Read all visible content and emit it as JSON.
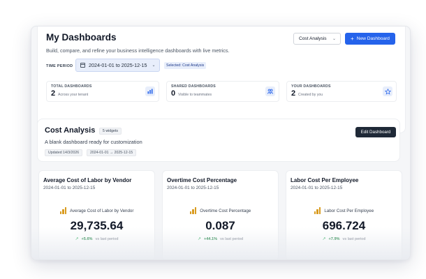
{
  "header": {
    "title": "My Dashboards",
    "subtitle": "Build, compare, and refine your business intelligence dashboards with live metrics.",
    "dashboard_select": {
      "value": "Cost Analysis"
    },
    "new_button": {
      "icon": "plus-icon",
      "label": "New Dashboard"
    }
  },
  "time_period": {
    "label": "TIME PERIOD",
    "value": "2024-01-01 to 2025-12-15",
    "selected_badge": "Selected: Cost Analysis"
  },
  "stats": [
    {
      "label": "TOTAL DASHBOARDS",
      "count": "2",
      "desc": "Across your tenant",
      "icon": "bar-chart-icon"
    },
    {
      "label": "SHARED DASHBOARDS",
      "count": "0",
      "desc": "Visible to teammates",
      "icon": "users-icon"
    },
    {
      "label": "YOUR DASHBOARDS",
      "count": "2",
      "desc": "Created by you",
      "icon": "star-icon"
    }
  ],
  "dashboard": {
    "title": "Cost Analysis",
    "widget_count": "5 widgets",
    "description": "A blank dashboard ready for customization",
    "updated": "Updated 14/3/2026",
    "range": "2024-01-01 → 2025-12-15",
    "edit_label": "Edit Dashboard"
  },
  "widgets": [
    {
      "title": "Average Cost of Labor by Vendor",
      "period": "2024-01-01 to 2025-12-15",
      "metric_label": "Average Cost of Labor by Vendor",
      "value": "29,735.64",
      "change": "+5.6%",
      "vs": "vs last period"
    },
    {
      "title": "Overtime Cost Percentage",
      "period": "2024-01-01 to 2025-12-15",
      "metric_label": "Overtime Cost Percentage",
      "value": "0.087",
      "change": "+44.1%",
      "vs": "vs last period"
    },
    {
      "title": "Labor Cost Per Employee",
      "period": "2024-01-01 to 2025-12-15",
      "metric_label": "Labor Cost Per Employee",
      "value": "696.724",
      "change": "+7.9%",
      "vs": "vs last period"
    }
  ],
  "colors": {
    "accent": "#2563eb",
    "dark_button": "#1f2937",
    "positive": "#16a34a",
    "metric_icon": "#d99b1f"
  }
}
